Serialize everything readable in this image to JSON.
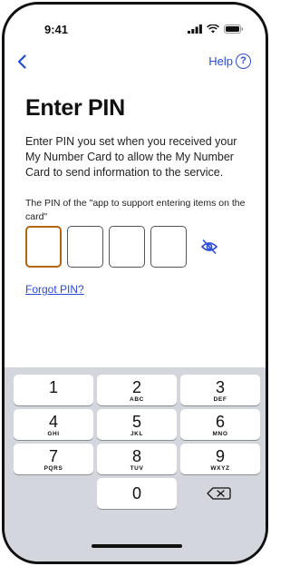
{
  "status": {
    "time": "9:41"
  },
  "nav": {
    "help_label": "Help",
    "help_icon_text": "?"
  },
  "title": "Enter PIN",
  "description": "Enter PIN you set when you received your My Number Card to allow the My Number Card to send information to the service.",
  "pin_label": "The PIN of the \"app to support entering items on the card\"",
  "pin_boxes": 4,
  "forgot_pin": "Forgot PIN?",
  "keypad": [
    {
      "num": "1",
      "letters": ""
    },
    {
      "num": "2",
      "letters": "ABC"
    },
    {
      "num": "3",
      "letters": "DEF"
    },
    {
      "num": "4",
      "letters": "GHI"
    },
    {
      "num": "5",
      "letters": "JKL"
    },
    {
      "num": "6",
      "letters": "MNO"
    },
    {
      "num": "7",
      "letters": "PQRS"
    },
    {
      "num": "8",
      "letters": "TUV"
    },
    {
      "num": "9",
      "letters": "WXYZ"
    },
    {
      "num": "0",
      "letters": ""
    }
  ],
  "colors": {
    "accent": "#2a4bd7",
    "active_box": "#b5650d",
    "keyboard_bg": "#d3d6dc"
  },
  "icons": [
    "chevron-left-icon",
    "help-circle-icon",
    "eye-slash-icon",
    "backspace-icon",
    "signal-icon",
    "wifi-icon",
    "battery-icon"
  ]
}
